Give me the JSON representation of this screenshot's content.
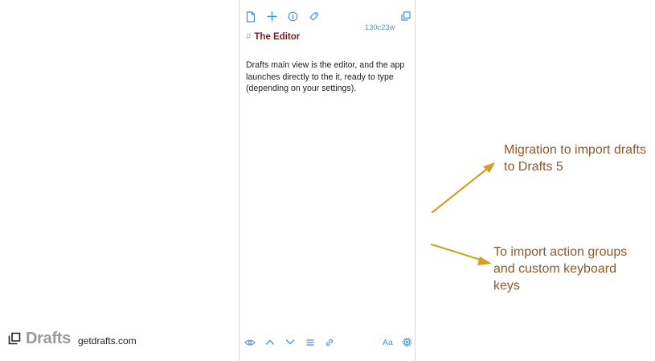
{
  "editor": {
    "stats": "130c23w",
    "heading_hash": "#",
    "heading": "The Editor",
    "body": "Drafts main view is the editor, and the app launches directly to the it, ready to type (depending on your settings).",
    "font_button": "Aa",
    "top_toolbar_icons": [
      "new-draft-icon",
      "add-icon",
      "info-icon",
      "tag-icon",
      "expand-icon"
    ],
    "bottom_toolbar_icons": [
      "preview-eye-icon",
      "arrow-up-icon",
      "arrow-down-icon",
      "list-icon",
      "link-icon",
      "settings-gear-icon"
    ]
  },
  "annotations": {
    "migration": "Migration to import drafts to Drafts 5",
    "import_actions": "To import action groups and custom keyboard keys"
  },
  "branding": {
    "name": "Drafts",
    "url": "getdrafts.com"
  },
  "colors": {
    "accent": "#4a90e2",
    "heading": "#7a1a14",
    "annotation_text": "#8b5a28",
    "arrow": "#d4a020"
  }
}
